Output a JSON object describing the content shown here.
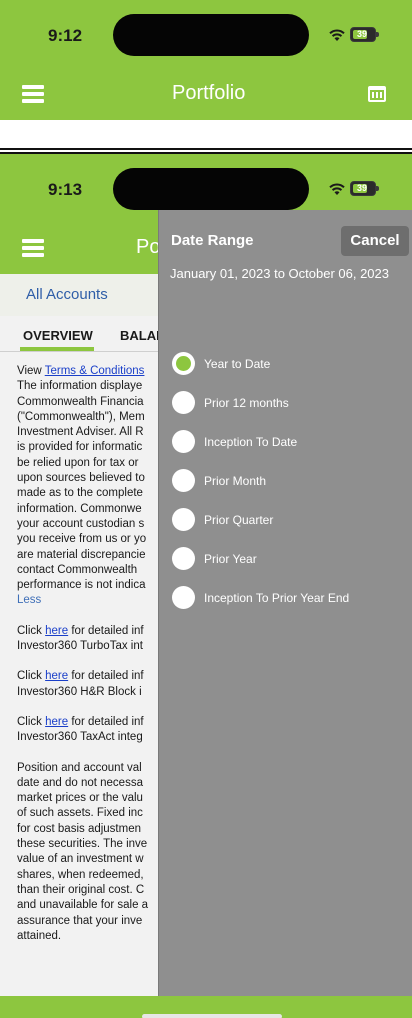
{
  "colors": {
    "brand_green": "#8dc63f",
    "panel_gray": "#8f8f8f",
    "cancel_gray": "#6e6e6e",
    "link_blue": "#2f5ea8"
  },
  "shot1": {
    "status": {
      "time": "9:12",
      "battery": "39"
    },
    "nav": {
      "title": "Portfolio",
      "menu_icon": "hamburger-icon",
      "calendar_icon": "calendar-icon"
    }
  },
  "shot2": {
    "status": {
      "time": "9:13",
      "battery": "39"
    },
    "nav": {
      "title_visible": "Po"
    },
    "account": "All Accounts",
    "tabs": [
      {
        "label": "OVERVIEW",
        "active": true
      },
      {
        "label": "BALAI",
        "active": false
      }
    ],
    "disclaimer": {
      "view_prefix": "View ",
      "terms_link": "Terms & Conditions",
      "lines": [
        "The information displaye",
        "Commonwealth Financia",
        "(\"Commonwealth\"), Mem",
        "Investment Adviser. All R",
        "is provided for informatic",
        "be relied upon for tax or",
        "upon sources believed to",
        "made as to the complete",
        "information. Commonwe",
        "your account custodian s",
        "you receive from us or yo",
        "are material discrepancie",
        "contact Commonwealth",
        "performance is not indica"
      ],
      "less": "Less",
      "click_prefix": "Click ",
      "here": "here",
      "click_suffix": " for detailed inf",
      "click_blocks": [
        {
          "suffix": " for detailed inf",
          "second_line": "Investor360 TurboTax int"
        },
        {
          "suffix": " for detailed inf",
          "second_line": "Investor360 H&R Block i"
        },
        {
          "suffix": " for detailed inf",
          "second_line": "Investor360 TaxAct integ"
        }
      ],
      "position_lines": [
        "Position and account val",
        "date and do not necessa",
        "market prices or the valu",
        "of such assets. Fixed inc",
        "for cost basis adjustmen",
        "these securities. The inve",
        "value of an investment w",
        "shares, when redeemed,",
        "than their original cost. C",
        "and unavailable for sale a",
        "assurance that your inve",
        "attained."
      ]
    },
    "date_panel": {
      "title": "Date Range",
      "cancel": "Cancel",
      "range": "January 01, 2023 to October 06, 2023",
      "selected_index": 0,
      "options": [
        "Year to Date",
        "Prior 12 months",
        "Inception To Date",
        "Prior Month",
        "Prior Quarter",
        "Prior Year",
        "Inception To Prior Year End"
      ]
    }
  }
}
